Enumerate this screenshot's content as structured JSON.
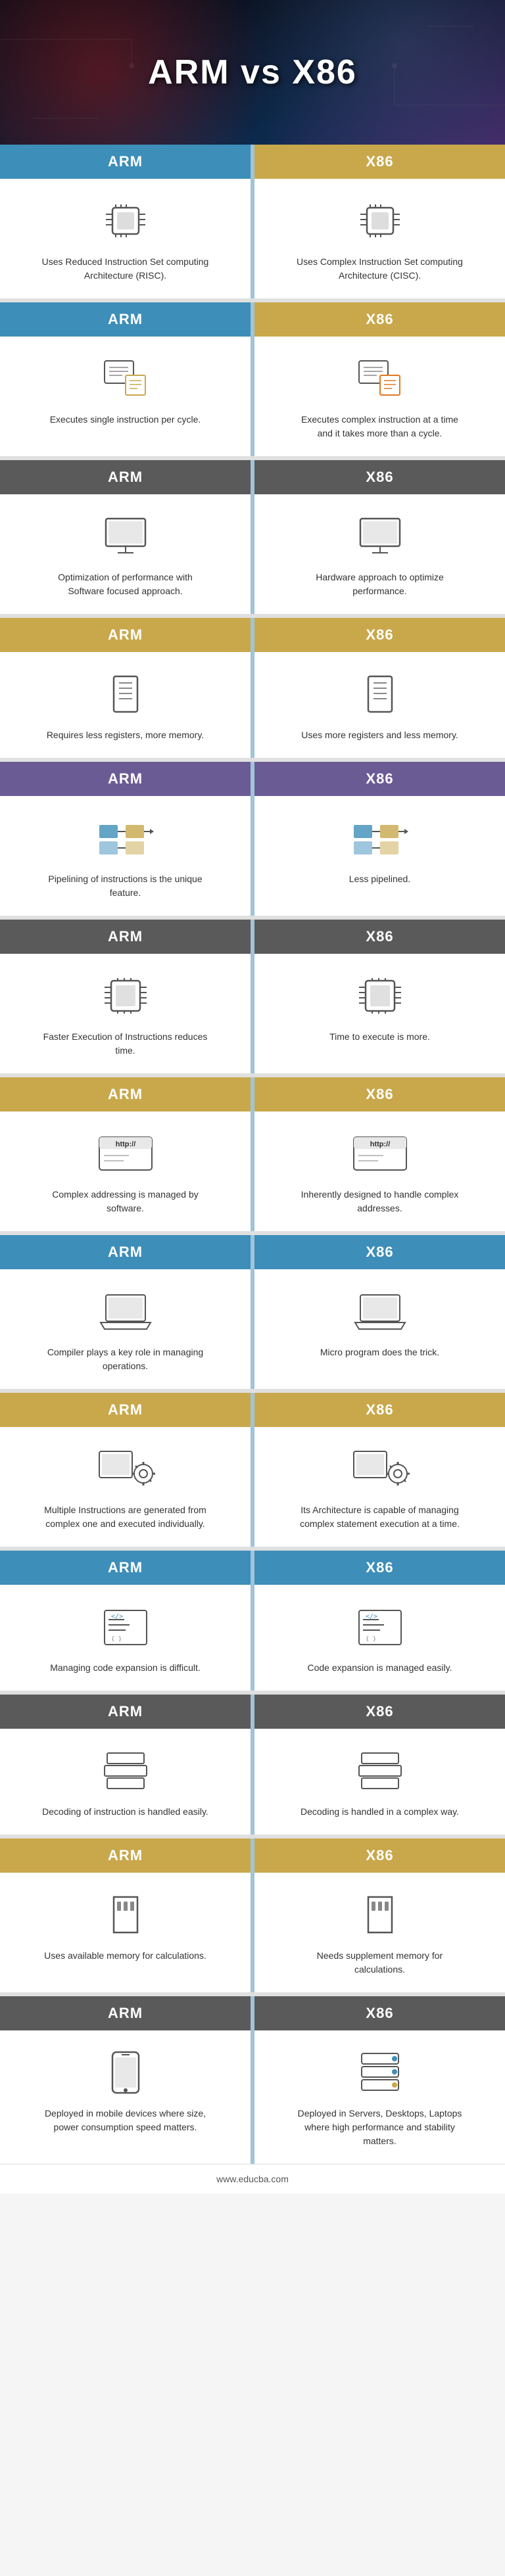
{
  "title": "ARM vs X86",
  "footer": "www.educba.com",
  "header_arm": "ARM",
  "header_x86": "X86",
  "rows": [
    {
      "id": "instruction-set",
      "arm_desc": "Uses Reduced Instruction Set computing Architecture (RISC).",
      "x86_desc": "Uses Complex Instruction Set computing Architecture (CISC).",
      "arm_icon": "chip",
      "x86_icon": "chip"
    },
    {
      "id": "execution",
      "arm_desc": "Executes single instruction per cycle.",
      "x86_desc": "Executes complex instruction at a time and it takes more than a cycle.",
      "arm_icon": "monitor-doc",
      "x86_icon": "monitor-doc-orange"
    },
    {
      "id": "performance",
      "arm_desc": "Optimization of performance with Software focused approach.",
      "x86_desc": "Hardware approach to optimize performance.",
      "arm_icon": "desktop",
      "x86_icon": "desktop"
    },
    {
      "id": "registers",
      "arm_desc": "Requires less registers, more memory.",
      "x86_desc": "Uses more registers and less memory.",
      "arm_icon": "memory-card",
      "x86_icon": "memory-card"
    },
    {
      "id": "pipelining",
      "arm_desc": "Pipelining of instructions is the unique feature.",
      "x86_desc": "Less pipelined.",
      "arm_icon": "pipeline",
      "x86_icon": "pipeline"
    },
    {
      "id": "execution-speed",
      "arm_desc": "Faster Execution of Instructions reduces time.",
      "x86_desc": "Time to execute is more.",
      "arm_icon": "chip2",
      "x86_icon": "chip2"
    },
    {
      "id": "addressing",
      "arm_desc": "Complex addressing is managed by software.",
      "x86_desc": "Inherently designed to handle complex addresses.",
      "arm_icon": "http",
      "x86_icon": "http"
    },
    {
      "id": "compiler",
      "arm_desc": "Compiler plays a key role in managing operations.",
      "x86_desc": "Micro program does the trick.",
      "arm_icon": "laptop",
      "x86_icon": "laptop"
    },
    {
      "id": "microinstructions",
      "arm_desc": "Multiple Instructions are generated from complex one and executed individually.",
      "x86_desc": "Its Architecture is capable of managing complex statement execution at a time.",
      "arm_icon": "gear-monitor",
      "x86_icon": "gear-monitor"
    },
    {
      "id": "code-expansion",
      "arm_desc": "Managing code expansion is difficult.",
      "x86_desc": "Code expansion is managed easily.",
      "arm_icon": "code",
      "x86_icon": "code"
    },
    {
      "id": "decoding",
      "arm_desc": "Decoding of instruction is handled easily.",
      "x86_desc": "Decoding is handled in a complex way.",
      "arm_icon": "layers",
      "x86_icon": "layers"
    },
    {
      "id": "memory",
      "arm_desc": "Uses available memory for calculations.",
      "x86_desc": "Needs supplement memory for calculations.",
      "arm_icon": "sd-card",
      "x86_icon": "sd-card"
    },
    {
      "id": "deployment",
      "arm_desc": "Deployed in mobile devices where size, power consumption speed matters.",
      "x86_desc": "Deployed in Servers, Desktops, Laptops where high performance and stability matters.",
      "arm_icon": "mobile",
      "x86_icon": "server"
    }
  ],
  "header_colors": [
    "#3d8eb9",
    "#c8a84b",
    "#3d8eb9",
    "#c8a84b",
    "#3d8eb9",
    "#c8a84b",
    "#3d8eb9",
    "#c8a84b",
    "#3d8eb9",
    "#c8a84b",
    "#3d8eb9",
    "#c8a84b",
    "#3d8eb9",
    "#c8a84b"
  ]
}
